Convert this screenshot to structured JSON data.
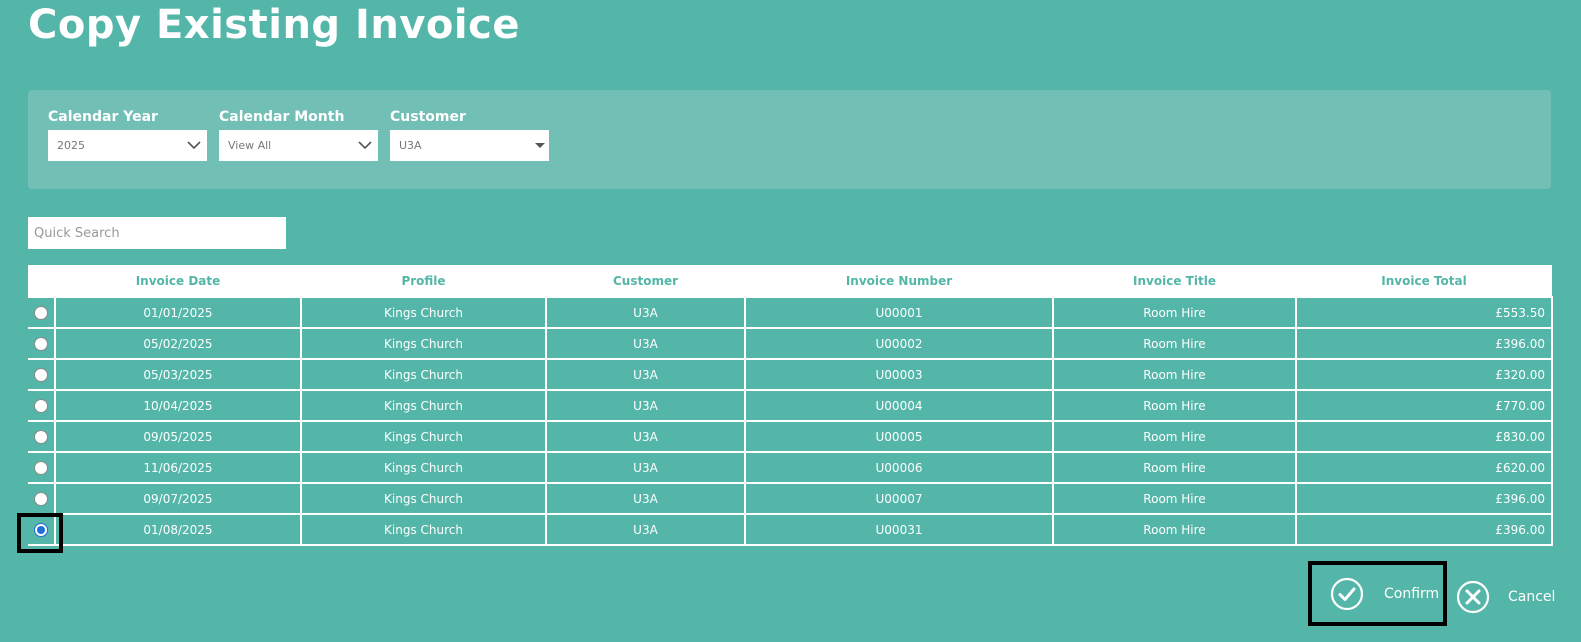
{
  "page": {
    "title": "Copy Existing Invoice"
  },
  "filters": {
    "year": {
      "label": "Calendar Year",
      "value": "2025"
    },
    "month": {
      "label": "Calendar Month",
      "value": "View All"
    },
    "customer": {
      "label": "Customer",
      "value": "U3A"
    }
  },
  "search": {
    "placeholder": "Quick Search"
  },
  "table": {
    "headers": [
      "",
      "Invoice Date",
      "Profile",
      "Customer",
      "Invoice Number",
      "Invoice Title",
      "Invoice Total"
    ],
    "rows": [
      {
        "date": "01/01/2025",
        "profile": "Kings Church",
        "customer": "U3A",
        "number": "U00001",
        "title": "Room Hire",
        "total": "£553.50",
        "selected": false
      },
      {
        "date": "05/02/2025",
        "profile": "Kings Church",
        "customer": "U3A",
        "number": "U00002",
        "title": "Room Hire",
        "total": "£396.00",
        "selected": false
      },
      {
        "date": "05/03/2025",
        "profile": "Kings Church",
        "customer": "U3A",
        "number": "U00003",
        "title": "Room Hire",
        "total": "£320.00",
        "selected": false
      },
      {
        "date": "10/04/2025",
        "profile": "Kings Church",
        "customer": "U3A",
        "number": "U00004",
        "title": "Room Hire",
        "total": "£770.00",
        "selected": false
      },
      {
        "date": "09/05/2025",
        "profile": "Kings Church",
        "customer": "U3A",
        "number": "U00005",
        "title": "Room Hire",
        "total": "£830.00",
        "selected": false
      },
      {
        "date": "11/06/2025",
        "profile": "Kings Church",
        "customer": "U3A",
        "number": "U00006",
        "title": "Room Hire",
        "total": "£620.00",
        "selected": false
      },
      {
        "date": "09/07/2025",
        "profile": "Kings Church",
        "customer": "U3A",
        "number": "U00007",
        "title": "Room Hire",
        "total": "£396.00",
        "selected": false
      },
      {
        "date": "01/08/2025",
        "profile": "Kings Church",
        "customer": "U3A",
        "number": "U00031",
        "title": "Room Hire",
        "total": "£396.00",
        "selected": true
      }
    ]
  },
  "actions": {
    "confirm_label": "Confirm",
    "cancel_label": "Cancel"
  },
  "colors": {
    "background": "#53b6a8",
    "panel": "#72bfb5",
    "header_text": "#53b6a8",
    "radio_selected": "#1e6fd9"
  }
}
